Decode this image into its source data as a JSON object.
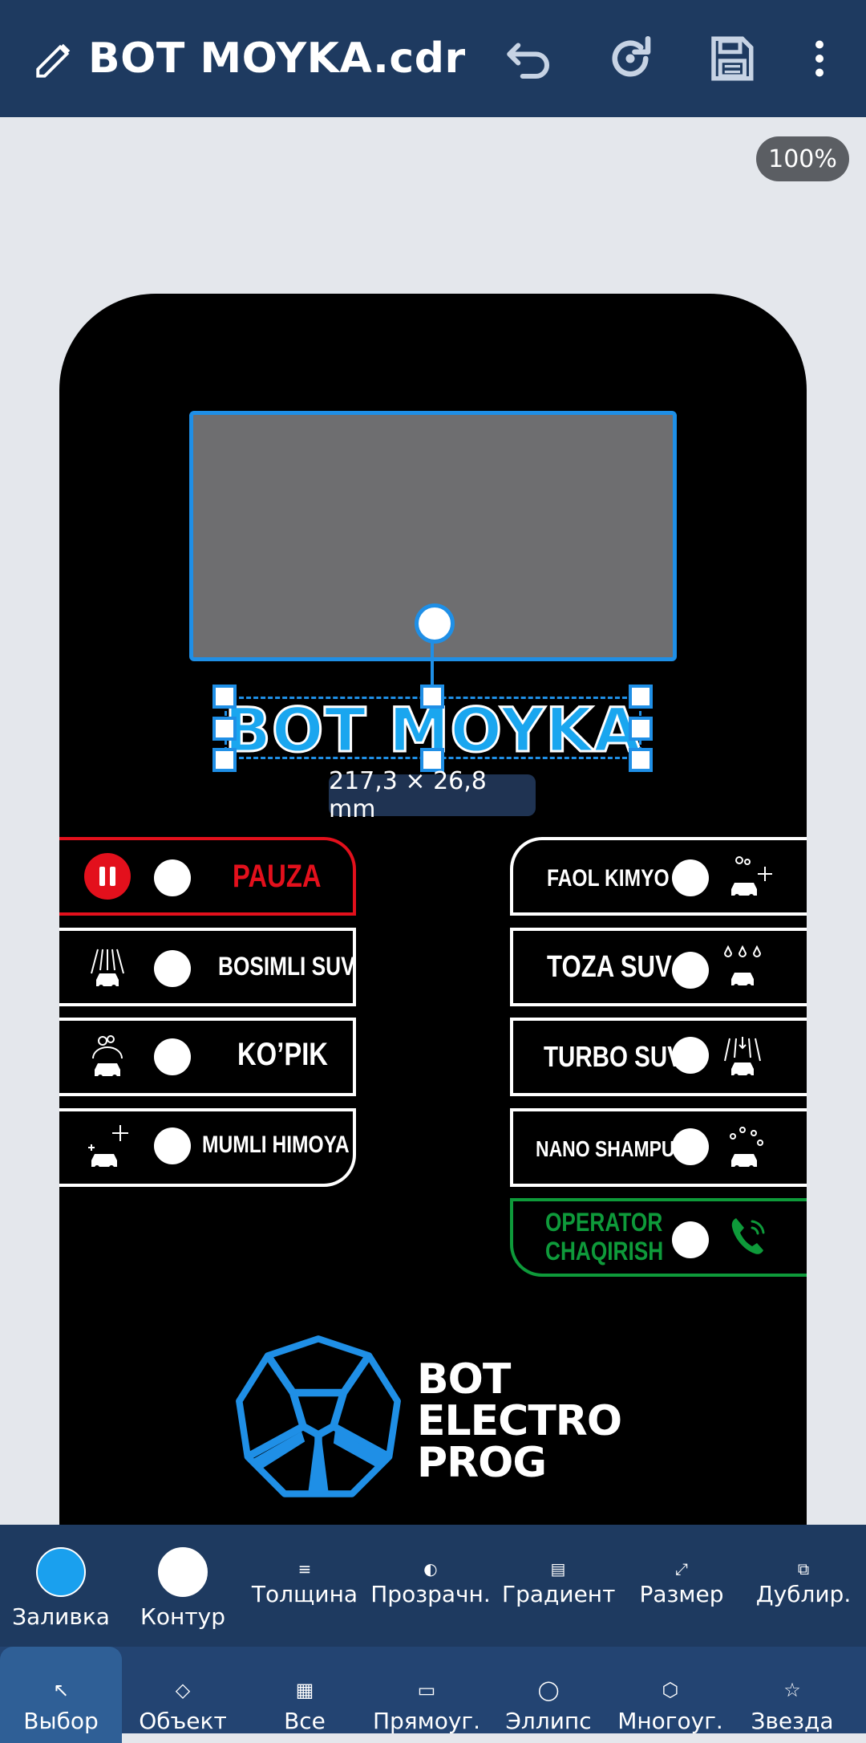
{
  "topbar": {
    "title": "BOT MOYKA.cdr",
    "icons": [
      "pencil-icon",
      "undo-icon",
      "redo-icon",
      "save-icon",
      "more-vert-icon"
    ]
  },
  "zoom": "100%",
  "canvas": {
    "headline": "BOT MOYKA",
    "dimensions": "217,3 × 26,8 mm",
    "left_buttons": [
      {
        "label": "PAUZA",
        "color": "#e3101c",
        "icon": "pause-icon"
      },
      {
        "label": "BOSIMLI SUV",
        "color": "#ffffff",
        "icon": "car-spray-icon"
      },
      {
        "label": "KO’PIK",
        "color": "#ffffff",
        "icon": "car-foam-icon"
      },
      {
        "label": "MUMLI HIMOYA",
        "color": "#ffffff",
        "icon": "car-shine-icon"
      }
    ],
    "right_buttons": [
      {
        "label": "FAOL KIMYO",
        "color": "#ffffff",
        "icon": "car-chemistry-icon"
      },
      {
        "label": "TOZA SUV",
        "color": "#ffffff",
        "icon": "car-drops-icon"
      },
      {
        "label": "TURBO SUV",
        "color": "#ffffff",
        "icon": "car-turbo-icon"
      },
      {
        "label": "NANO SHAMPUN",
        "color": "#ffffff",
        "icon": "car-shampoo-icon"
      },
      {
        "label_line1": "OPERATOR",
        "label_line2": "CHAQIRISH",
        "color": "#0e9a3a",
        "icon": "phone-icon"
      }
    ],
    "logo_line1": "BOT",
    "logo_line2": "ELECTRO",
    "logo_line3": "PROG",
    "accent": "#1f8fe6"
  },
  "toolbar_top": [
    {
      "label": "Заливка",
      "swatch": "#1aa0ee"
    },
    {
      "label": "Контур",
      "swatch": "#ffffff"
    },
    {
      "label": "Толщина",
      "icon": "≡"
    },
    {
      "label": "Прозрачн.",
      "icon": "◐"
    },
    {
      "label": "Градиент",
      "icon": "▤"
    },
    {
      "label": "Размер",
      "icon": "⤢"
    },
    {
      "label": "Дублир.",
      "icon": "⧉"
    }
  ],
  "toolbar_bottom": [
    {
      "label": "Выбор",
      "icon": "↖"
    },
    {
      "label": "Объект",
      "icon": "◇"
    },
    {
      "label": "Все",
      "icon": "▦"
    },
    {
      "label": "Прямоуг.",
      "icon": "▭"
    },
    {
      "label": "Эллипс",
      "icon": "◯"
    },
    {
      "label": "Многоуг.",
      "icon": "⬡"
    },
    {
      "label": "Звезда",
      "icon": "☆"
    }
  ]
}
